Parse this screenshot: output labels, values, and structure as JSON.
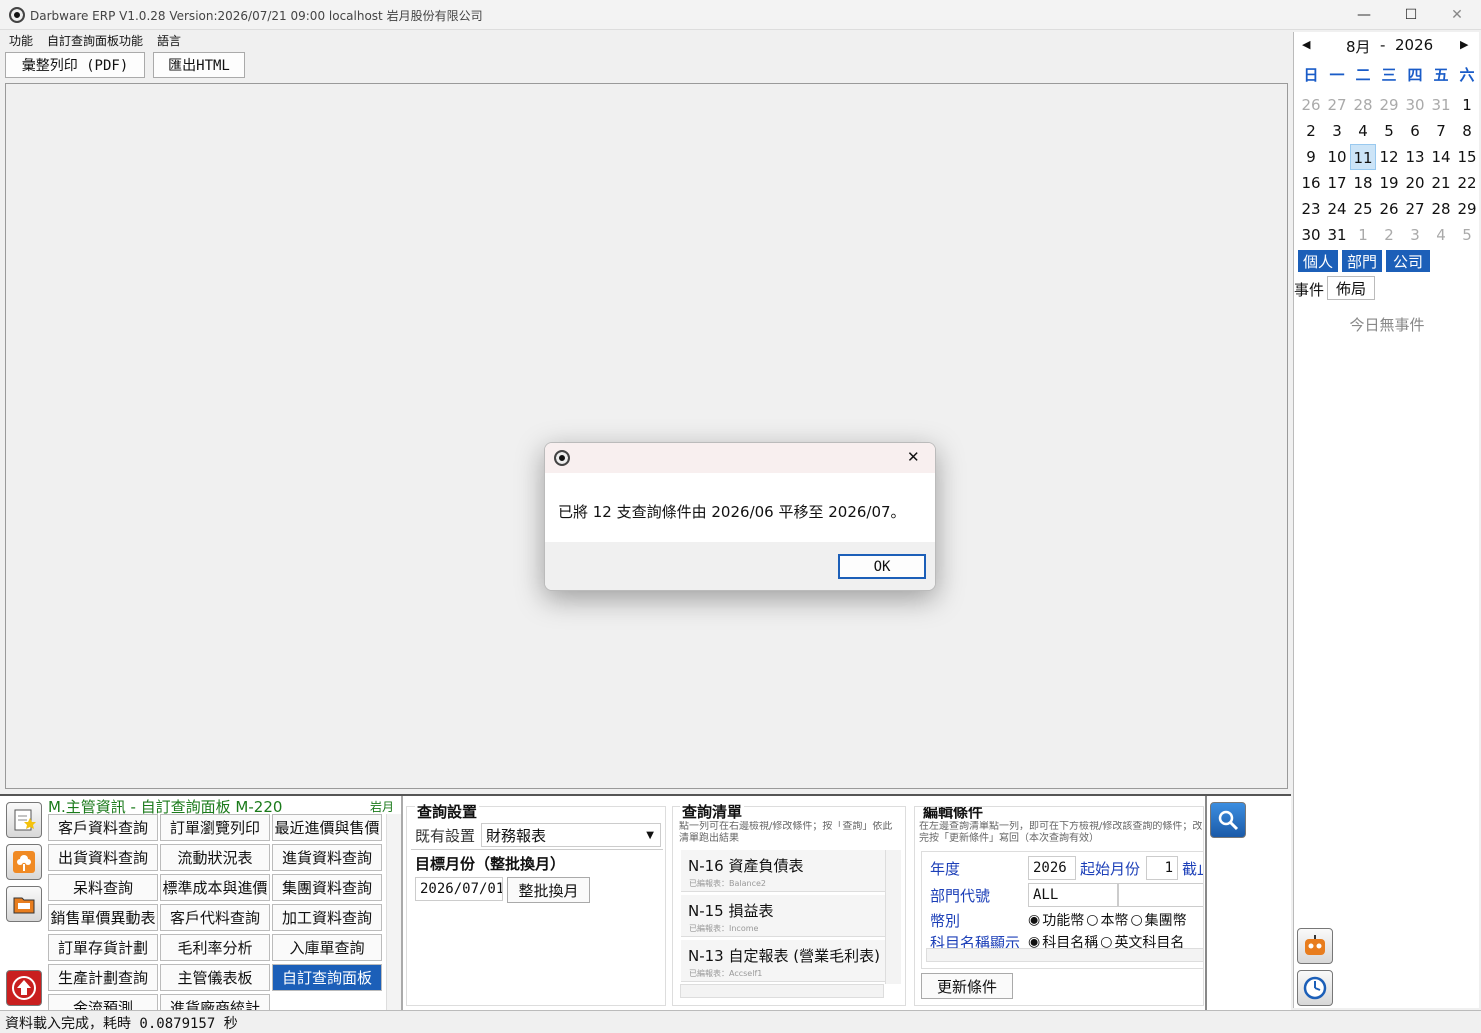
{
  "window": {
    "title": "Darbware ERP V1.0.28 Version:2026/07/21 09:00   localhost 岩月股份有限公司",
    "minimize": "—",
    "maximize": "☐",
    "close": "✕"
  },
  "menu": [
    "功能",
    "自訂查詢面板功能",
    "語言"
  ],
  "toolbar": {
    "print_pdf": "彙整列印 (PDF)",
    "export_html": "匯出HTML"
  },
  "calendar": {
    "month_label": "8月",
    "dash": "-",
    "year": "2026",
    "prev": "◀",
    "next": "▶",
    "weekdays": [
      "日",
      "一",
      "二",
      "三",
      "四",
      "五",
      "六"
    ],
    "weeks": [
      [
        "26",
        "27",
        "28",
        "29",
        "30",
        "31",
        "1"
      ],
      [
        "2",
        "3",
        "4",
        "5",
        "6",
        "7",
        "8"
      ],
      [
        "9",
        "10",
        "11",
        "12",
        "13",
        "14",
        "15"
      ],
      [
        "16",
        "17",
        "18",
        "19",
        "20",
        "21",
        "22"
      ],
      [
        "23",
        "24",
        "25",
        "26",
        "27",
        "28",
        "29"
      ],
      [
        "30",
        "31",
        "1",
        "2",
        "3",
        "4",
        "5"
      ]
    ],
    "selected": "11",
    "tabs": [
      "個人",
      "部門",
      "公司"
    ],
    "event_label": "事件",
    "layout_button": "佈局",
    "no_events": "今日無事件"
  },
  "bottom": {
    "module_title": "M.主管資訊 - 自訂查詢面板  M-220",
    "company_short": "岩月",
    "module_buttons": [
      [
        "客戶資料查詢",
        "訂單瀏覽列印",
        "最近進價與售價"
      ],
      [
        "出貨資料查詢",
        "流動狀況表",
        "進貨資料查詢"
      ],
      [
        "呆料查詢",
        "標準成本與進價",
        "集團資料查詢"
      ],
      [
        "銷售單價異動表",
        "客戶代料查詢",
        "加工資料查詢"
      ],
      [
        "訂單存貨計劃",
        "毛利率分析",
        "入庫單查詢"
      ],
      [
        "生產計劃查詢",
        "主管儀表板",
        "自訂查詢面板"
      ],
      [
        "金流預測",
        "進貨廠商統計",
        ""
      ]
    ],
    "query_settings": {
      "title": "查詢設置",
      "existing_label": "既有設置",
      "existing_value": "財務報表",
      "target_month_title": "目標月份（整批換月）",
      "target_month_value": "2026/07/01",
      "batch_button": "整批換月"
    },
    "query_list": {
      "title": "查詢清單",
      "hint": "點一列可在右邊檢視/修改條件；按「查詢」依此清單跑出結果",
      "items": [
        {
          "title": "N-16  資產負債表",
          "sub": "已編報表：Balance2"
        },
        {
          "title": "N-15  損益表",
          "sub": "已編報表：Income"
        },
        {
          "title": "N-13  自定報表 (營業毛利表)",
          "sub": "已編報表：Accself1"
        }
      ]
    },
    "edit_conditions": {
      "title": "編輯條件",
      "hint": "在左邊查詢清單點一列，即可在下方檢視/修改該查詢的條件；改完按「更新條件」寫回（本次查詢有效）",
      "year_label": "年度",
      "year_value": "2026",
      "start_month_label": "起始月份",
      "start_month_value": "1",
      "end_label": "截止",
      "dept_label": "部門代號",
      "dept_value": "ALL",
      "currency_label": "幣別",
      "currency_options": [
        "功能幣",
        "本幣",
        "集團幣"
      ],
      "account_label": "科目名稱顯示",
      "account_options": [
        "科目名稱",
        "英文科目名"
      ],
      "update_button": "更新條件"
    }
  },
  "dialog": {
    "message": "已將 12 支查詢條件由 2026/06 平移至 2026/07。",
    "ok": "OK",
    "close": "✕"
  },
  "status": "資料載入完成，耗時 0.0879157 秒"
}
